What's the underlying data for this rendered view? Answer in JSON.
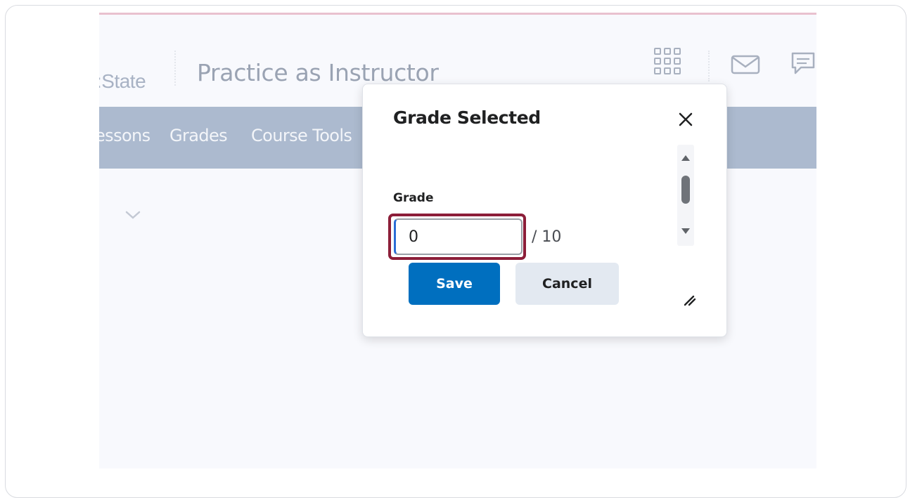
{
  "header": {
    "brand": ":State",
    "course_title": "Practice as Instructor",
    "icons": [
      "apps-grid-icon",
      "mail-icon",
      "chat-icon"
    ]
  },
  "nav": {
    "items": [
      "essons",
      "Grades",
      "Course Tools"
    ]
  },
  "dialog": {
    "title": "Grade Selected",
    "close_icon": "close-icon",
    "field_label": "Grade",
    "grade_value": "0",
    "out_of": "/ 10",
    "save_label": "Save",
    "cancel_label": "Cancel",
    "resize_icon": "resize-handle-icon"
  },
  "colors": {
    "navbar": "#acbacf",
    "primary": "#006fbf",
    "highlight": "#8c1e39",
    "top_accent": "#e9c1cf"
  }
}
